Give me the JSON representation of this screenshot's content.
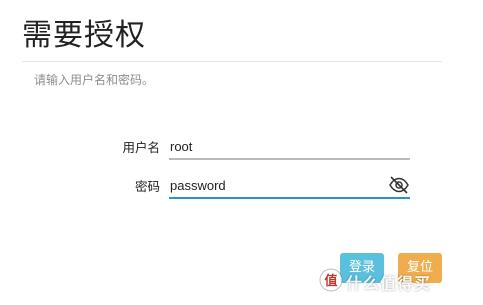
{
  "page": {
    "title": "需要授权",
    "subtitle": "请输入用户名和密码。"
  },
  "form": {
    "username": {
      "label": "用户名",
      "value": "root"
    },
    "password": {
      "label": "密码",
      "value": "password",
      "toggle_icon": "eye-slash-icon"
    }
  },
  "actions": {
    "login_label": "登录",
    "reset_label": "复位"
  },
  "watermark": {
    "text": "什么值得买"
  },
  "colors": {
    "login_button": "#5bc0de",
    "reset_button": "#f0ad4e",
    "focus_underline": "#2f8fd0"
  }
}
